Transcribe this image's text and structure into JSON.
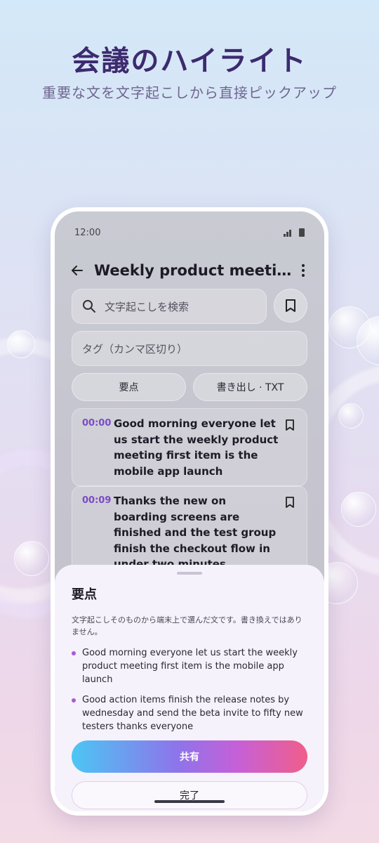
{
  "hero": {
    "title": "会議のハイライト",
    "subtitle": "重要な文を文字起こしから直接ピックアップ"
  },
  "status_bar": {
    "time": "12:00"
  },
  "appbar": {
    "title": "Weekly product meeting.m..."
  },
  "search": {
    "placeholder": "文字起こしを検索"
  },
  "tags": {
    "placeholder": "タグ（カンマ区切り）"
  },
  "actions": {
    "highlights_label": "要点",
    "export_label": "書き出し · TXT"
  },
  "segments": [
    {
      "time": "00:00",
      "text": "Good morning everyone let us start the weekly product meeting first item is the mobile app launch"
    },
    {
      "time": "00:09",
      "text": "Thanks the new on boarding screens are finished and the test group finish the checkout flow in under two minutes"
    }
  ],
  "sheet": {
    "title": "要点",
    "note": "文字起こしそのものから端末上で選んだ文です。書き換えではありません。",
    "bullets": [
      "Good morning everyone let us start the weekly product meeting first item is the mobile app launch",
      "Good action items finish the release notes by wednesday and send the beta invite to fifty new testers thanks everyone"
    ],
    "share_label": "共有",
    "done_label": "完了"
  },
  "colors": {
    "accent_purple": "#7b4bc8",
    "share_gradient": [
      "#4cc6f4",
      "#8e74ea",
      "#c560d8",
      "#f05e8a"
    ]
  }
}
